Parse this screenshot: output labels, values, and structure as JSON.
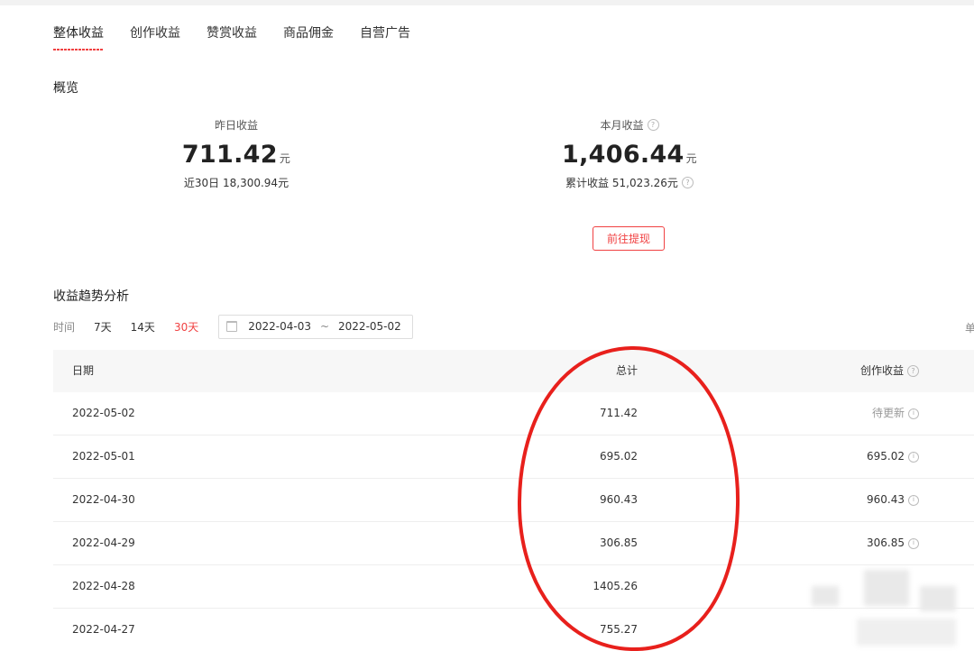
{
  "tabs": [
    {
      "label": "整体收益",
      "active": true
    },
    {
      "label": "创作收益",
      "active": false
    },
    {
      "label": "赞赏收益",
      "active": false
    },
    {
      "label": "商品佣金",
      "active": false
    },
    {
      "label": "自营广告",
      "active": false
    }
  ],
  "overview": {
    "title": "概览",
    "yesterday": {
      "label": "昨日收益",
      "value": "711.42",
      "unit": "元",
      "sub": "近30日 18,300.94元"
    },
    "month": {
      "label": "本月收益",
      "value": "1,406.44",
      "unit": "元",
      "sub": "累计收益 51,023.26元"
    },
    "withdraw_button": "前往提现"
  },
  "trend": {
    "title": "收益趋势分析",
    "time_label": "时间",
    "options": [
      {
        "label": "7天",
        "active": false
      },
      {
        "label": "14天",
        "active": false
      },
      {
        "label": "30天",
        "active": true
      }
    ],
    "date_start": "2022-04-03",
    "date_sep": "~",
    "date_end": "2022-05-02",
    "right_cut_text": "单"
  },
  "table": {
    "headers": {
      "date": "日期",
      "total": "总计",
      "creation": "创作收益"
    },
    "rows": [
      {
        "date": "2022-05-02",
        "total": "711.42",
        "creation": "待更新"
      },
      {
        "date": "2022-05-01",
        "total": "695.02",
        "creation": "695.02"
      },
      {
        "date": "2022-04-30",
        "total": "960.43",
        "creation": "960.43"
      },
      {
        "date": "2022-04-29",
        "total": "306.85",
        "creation": "306.85"
      },
      {
        "date": "2022-04-28",
        "total": "1405.26",
        "creation": ""
      },
      {
        "date": "2022-04-27",
        "total": "755.27",
        "creation": ""
      }
    ]
  },
  "colors": {
    "accent": "#f04142",
    "annotation": "#e8201c",
    "header_bg": "#f7f7f7"
  },
  "icons": {
    "help": "question-circle-icon",
    "info": "info-circle-icon",
    "calendar": "calendar-icon"
  }
}
